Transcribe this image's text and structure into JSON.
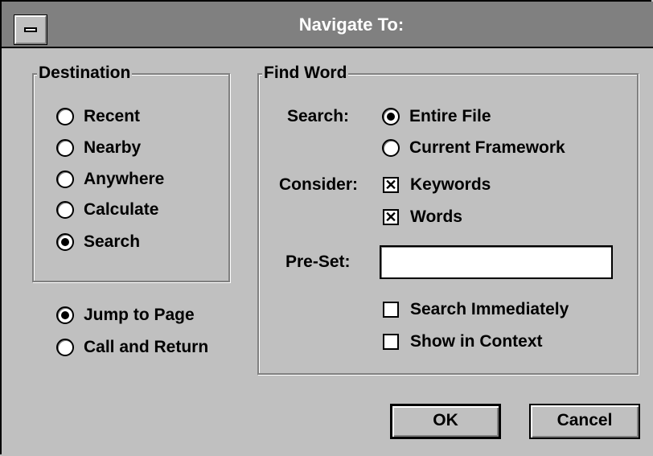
{
  "window": {
    "title": "Navigate To:"
  },
  "destination": {
    "label": "Destination",
    "options": [
      {
        "label": "Recent",
        "selected": false
      },
      {
        "label": "Nearby",
        "selected": false
      },
      {
        "label": "Anywhere",
        "selected": false
      },
      {
        "label": "Calculate",
        "selected": false
      },
      {
        "label": "Search",
        "selected": true
      }
    ]
  },
  "mode": {
    "options": [
      {
        "label": "Jump to Page",
        "selected": true
      },
      {
        "label": "Call and Return",
        "selected": false
      }
    ]
  },
  "find_word": {
    "label": "Find Word",
    "search_label": "Search:",
    "search_options": [
      {
        "label": "Entire File",
        "selected": true
      },
      {
        "label": "Current Framework",
        "selected": false
      }
    ],
    "consider_label": "Consider:",
    "consider_options": [
      {
        "label": "Keywords",
        "checked": true
      },
      {
        "label": "Words",
        "checked": true
      }
    ],
    "preset_label": "Pre-Set:",
    "preset_value": "",
    "extra_options": [
      {
        "label": "Search Immediately",
        "checked": false
      },
      {
        "label": "Show in Context",
        "checked": false
      }
    ]
  },
  "buttons": {
    "ok": "OK",
    "cancel": "Cancel"
  },
  "colors": {
    "face": "#c0c0c0",
    "title_bar": "#808080",
    "title_text": "#ffffff"
  }
}
